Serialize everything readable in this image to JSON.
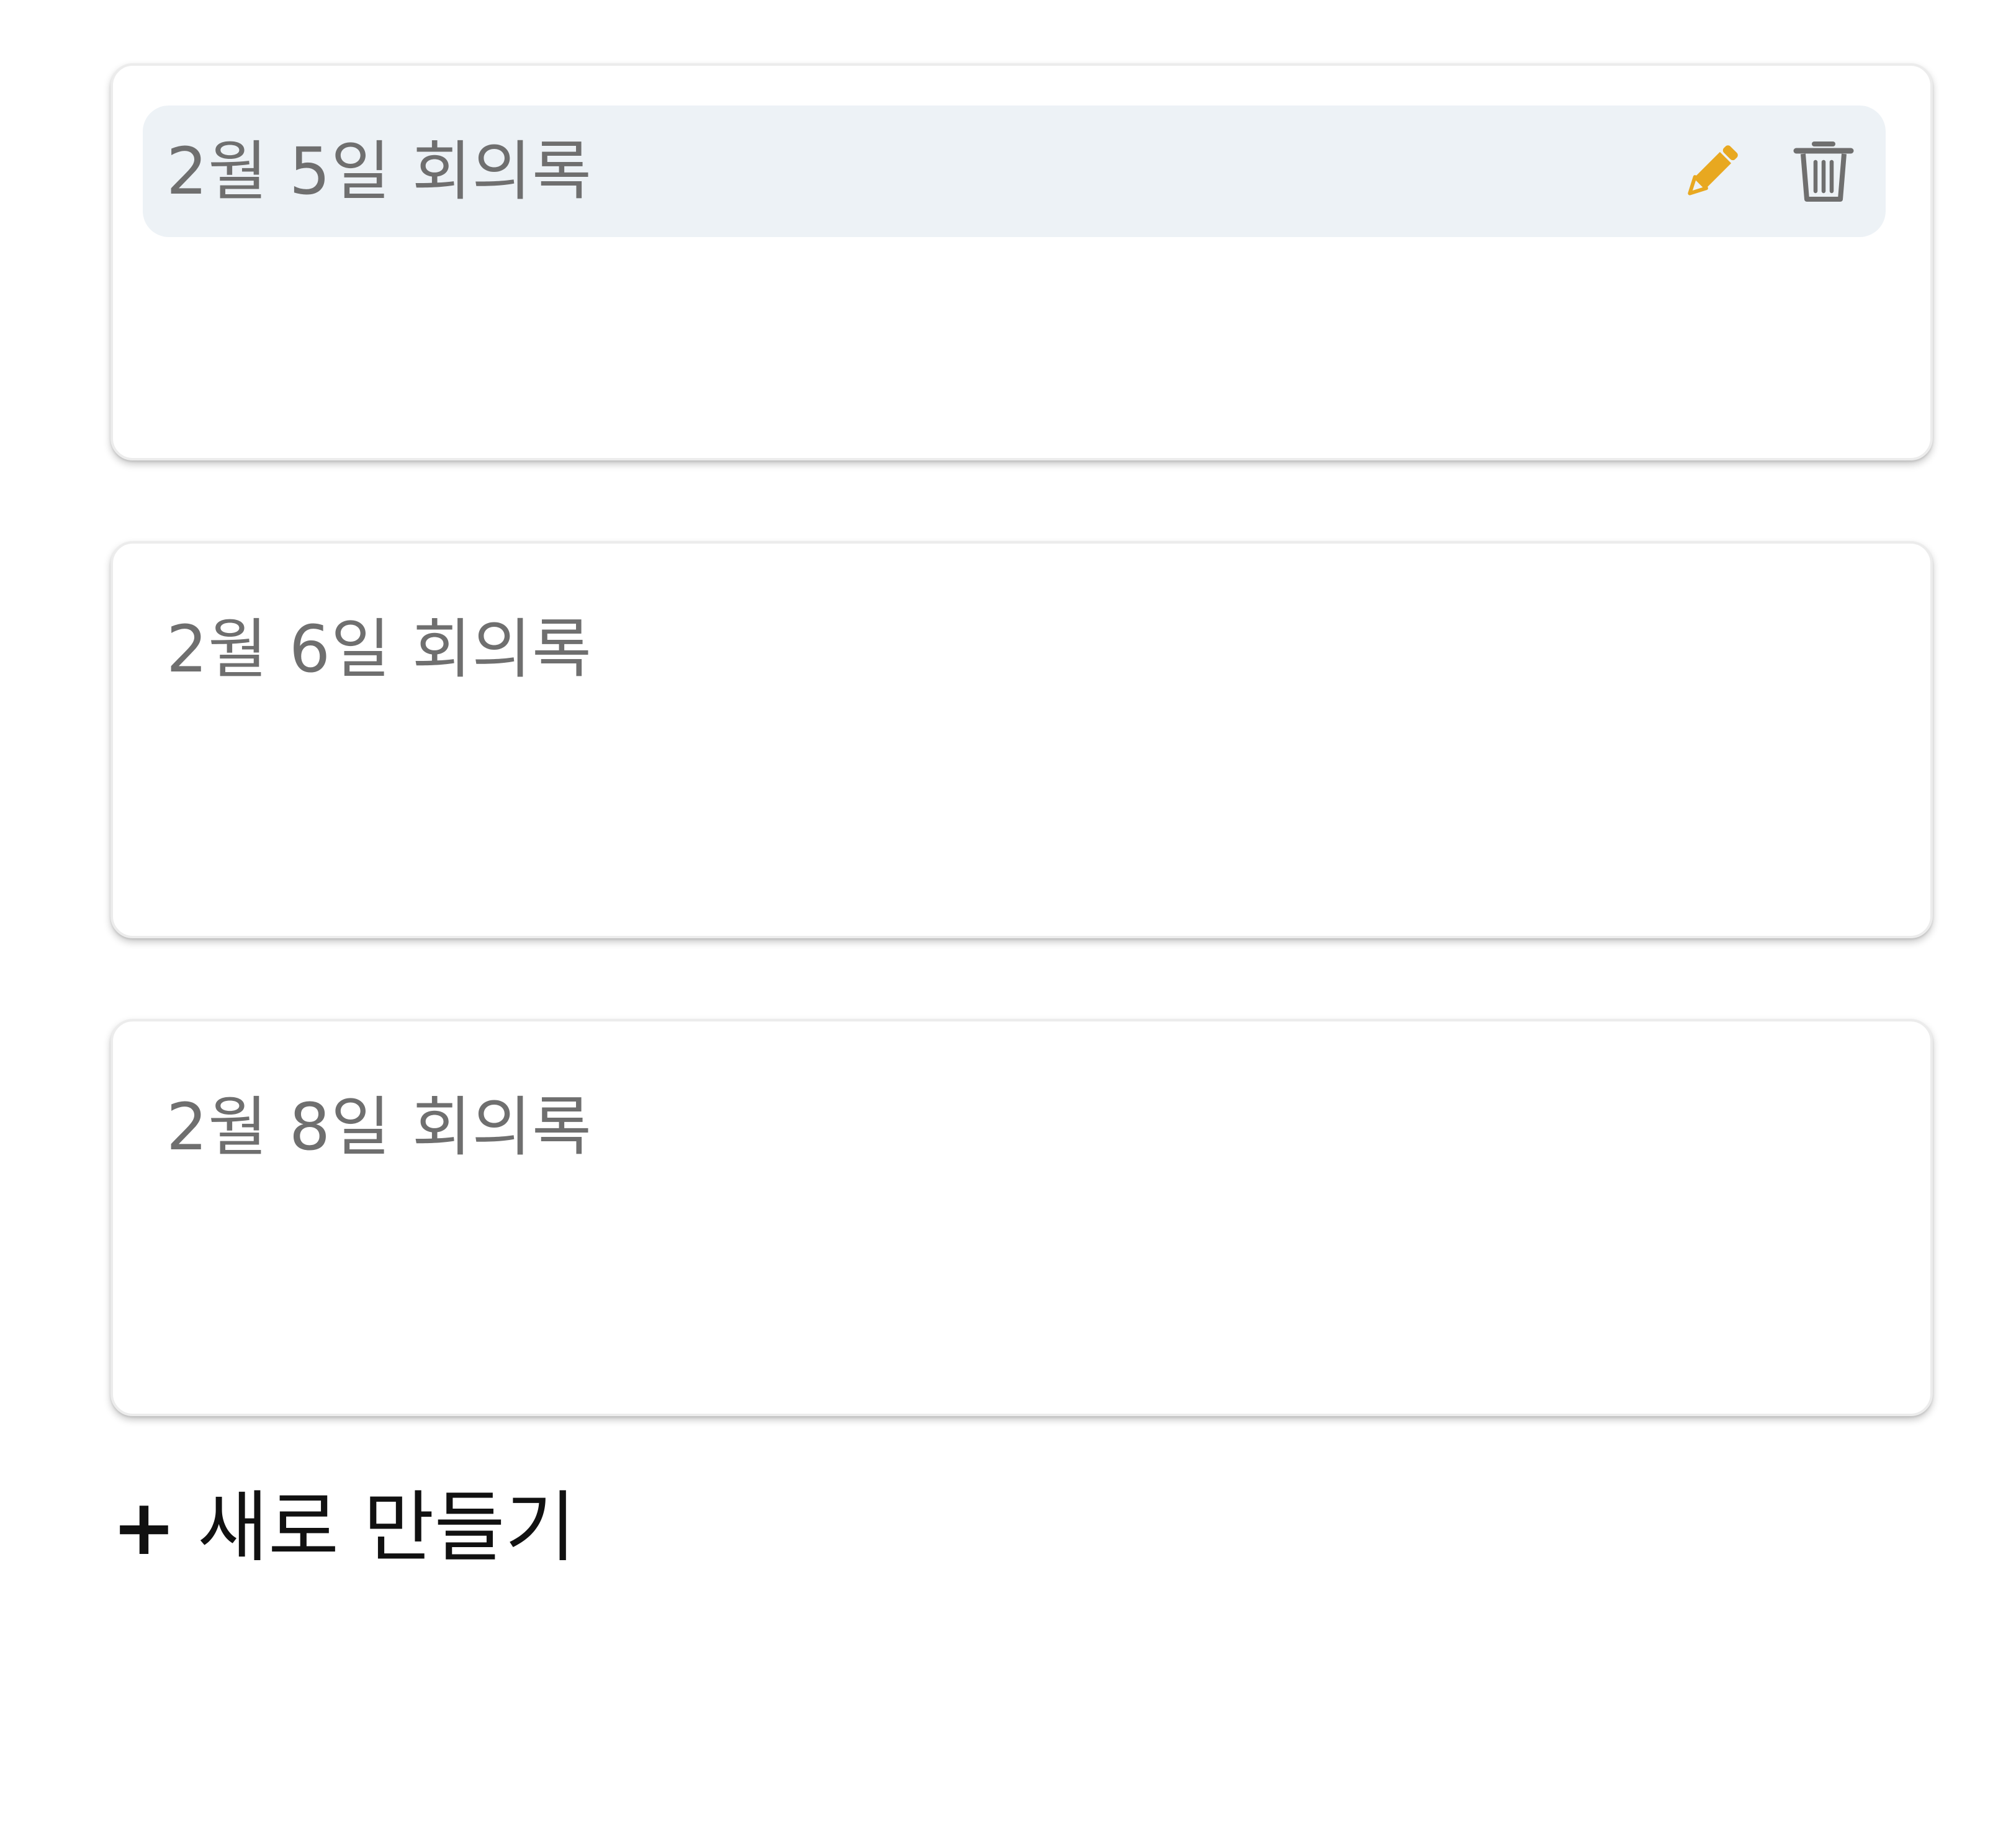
{
  "notes": [
    {
      "title": "2월 5일 회의록",
      "selected": true,
      "actions": [
        {
          "name": "edit",
          "icon": "pencil-icon",
          "color": "#e8a820"
        },
        {
          "name": "delete",
          "icon": "trash-icon",
          "color": "#6f6f6f"
        }
      ]
    },
    {
      "title": "2월 6일 회의록",
      "selected": false
    },
    {
      "title": "2월 8일 회의록",
      "selected": false
    }
  ],
  "new_button": {
    "plus": "+",
    "label": "새로 만들기"
  },
  "colors": {
    "selected_header_bg": "#edf2f6",
    "title_text": "#6f6f6f",
    "edit_icon": "#e8a820",
    "delete_icon": "#6f6f6f",
    "new_button_text": "#111111"
  }
}
